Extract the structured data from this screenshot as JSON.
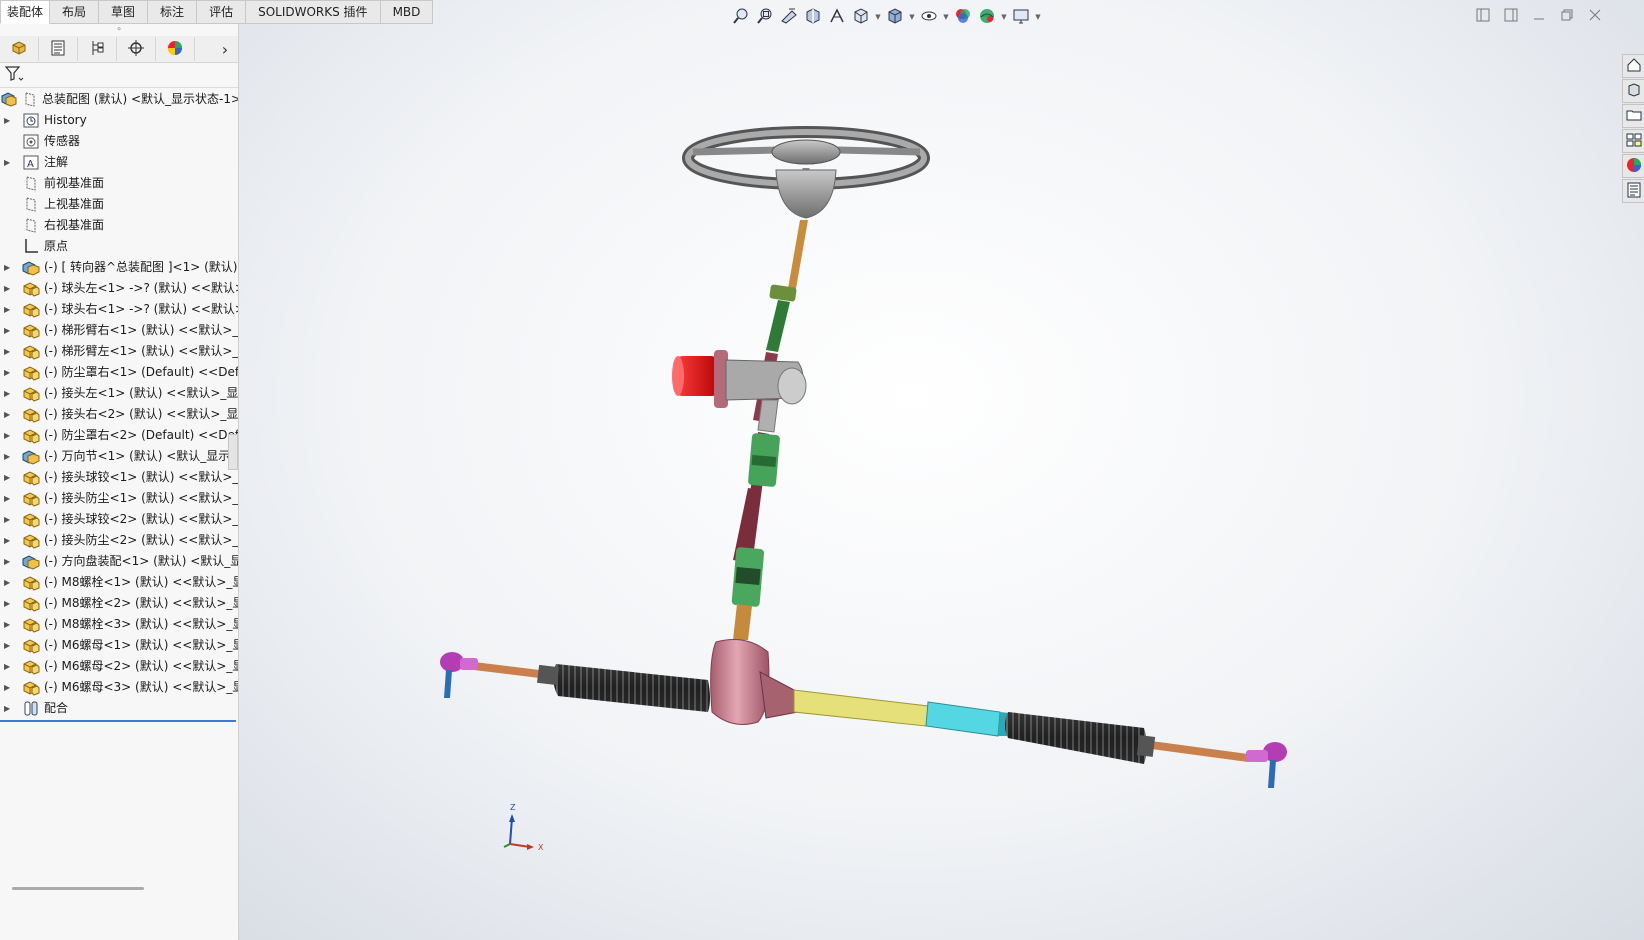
{
  "tabs": [
    {
      "label": "装配体",
      "active": true
    },
    {
      "label": "布局"
    },
    {
      "label": "草图"
    },
    {
      "label": "标注"
    },
    {
      "label": "评估"
    },
    {
      "label": "SOLIDWORKS 插件"
    },
    {
      "label": "MBD"
    }
  ],
  "panel_tabs": [
    {
      "icon": "feature-manager-icon"
    },
    {
      "icon": "property-manager-icon"
    },
    {
      "icon": "configuration-manager-icon"
    },
    {
      "icon": "dimxpert-manager-icon"
    },
    {
      "icon": "display-manager-icon"
    }
  ],
  "panel_more": "›",
  "tree": [
    {
      "label": "总装配图 (默认) <默认_显示状态-1>",
      "icon": "top-assembly-icon",
      "caret": false,
      "indent": 0
    },
    {
      "label": "History",
      "icon": "history-icon",
      "caret": true,
      "indent": 1
    },
    {
      "label": "传感器",
      "icon": "sensor-icon",
      "caret": false,
      "indent": 1
    },
    {
      "label": "注解",
      "icon": "annotation-icon",
      "caret": true,
      "indent": 1
    },
    {
      "label": "前视基准面",
      "icon": "plane-icon",
      "caret": false,
      "indent": 1
    },
    {
      "label": "上视基准面",
      "icon": "plane-icon",
      "caret": false,
      "indent": 1
    },
    {
      "label": "右视基准面",
      "icon": "plane-icon",
      "caret": false,
      "indent": 1
    },
    {
      "label": "原点",
      "icon": "origin-icon",
      "caret": false,
      "indent": 1
    },
    {
      "label": "(-) [ 转向器^总装配图 ]<1> (默认)",
      "icon": "subassembly-icon",
      "caret": true,
      "indent": 1
    },
    {
      "label": "(-) 球头左<1> ->? (默认) <<默认>",
      "icon": "part-icon",
      "caret": true,
      "indent": 1
    },
    {
      "label": "(-) 球头右<1> ->? (默认) <<默认>",
      "icon": "part-icon",
      "caret": true,
      "indent": 1
    },
    {
      "label": "(-) 梯形臂右<1> (默认) <<默认>_显",
      "icon": "part-icon",
      "caret": true,
      "indent": 1
    },
    {
      "label": "(-) 梯形臂左<1> (默认) <<默认>_显",
      "icon": "part-icon",
      "caret": true,
      "indent": 1
    },
    {
      "label": "(-) 防尘罩右<1> (Default) <<Defa",
      "icon": "part-icon",
      "caret": true,
      "indent": 1
    },
    {
      "label": "(-) 接头左<1> (默认) <<默认>_显示",
      "icon": "part-icon",
      "caret": true,
      "indent": 1
    },
    {
      "label": "(-) 接头右<2> (默认) <<默认>_显示",
      "icon": "part-icon",
      "caret": true,
      "indent": 1
    },
    {
      "label": "(-) 防尘罩右<2> (Default) <<Defa",
      "icon": "part-icon",
      "caret": true,
      "indent": 1
    },
    {
      "label": "(-) 万向节<1> (默认) <默认_显示状",
      "icon": "subassembly-icon",
      "caret": true,
      "indent": 1
    },
    {
      "label": "(-) 接头球铰<1> (默认) <<默认>_显",
      "icon": "part-icon",
      "caret": true,
      "indent": 1
    },
    {
      "label": "(-) 接头防尘<1> (默认) <<默认>_显",
      "icon": "part-icon",
      "caret": true,
      "indent": 1
    },
    {
      "label": "(-) 接头球铰<2> (默认) <<默认>_显",
      "icon": "part-icon",
      "caret": true,
      "indent": 1
    },
    {
      "label": "(-) 接头防尘<2> (默认) <<默认>_显",
      "icon": "part-icon",
      "caret": true,
      "indent": 1
    },
    {
      "label": "(-) 方向盘装配<1> (默认) <默认_显",
      "icon": "subassembly-icon",
      "caret": true,
      "indent": 1
    },
    {
      "label": "(-) M8螺栓<1> (默认) <<默认>_显",
      "icon": "part-icon",
      "caret": true,
      "indent": 1
    },
    {
      "label": "(-) M8螺栓<2> (默认) <<默认>_显",
      "icon": "part-icon",
      "caret": true,
      "indent": 1
    },
    {
      "label": "(-) M8螺栓<3> (默认) <<默认>_显",
      "icon": "part-icon",
      "caret": true,
      "indent": 1
    },
    {
      "label": "(-) M6螺母<1> (默认) <<默认>_显",
      "icon": "part-icon",
      "caret": true,
      "indent": 1
    },
    {
      "label": "(-) M6螺母<2> (默认) <<默认>_显",
      "icon": "part-icon",
      "caret": true,
      "indent": 1
    },
    {
      "label": "(-) M6螺母<3> (默认) <<默认>_显",
      "icon": "part-icon",
      "caret": true,
      "indent": 1
    },
    {
      "label": "配合",
      "icon": "mates-icon",
      "caret": true,
      "indent": 1
    }
  ],
  "heads_up_toolbar": [
    {
      "icon": "zoom-to-fit-icon",
      "drop": false
    },
    {
      "icon": "zoom-to-area-icon",
      "drop": false
    },
    {
      "icon": "previous-view-icon",
      "drop": false
    },
    {
      "icon": "section-view-icon",
      "drop": false
    },
    {
      "icon": "dynamic-annotation-icon",
      "drop": false
    },
    {
      "icon": "view-orientation-icon",
      "drop": true
    },
    {
      "icon": "display-style-icon",
      "drop": true
    },
    {
      "icon": "hide-show-items-icon",
      "drop": true
    },
    {
      "icon": "edit-appearance-icon",
      "drop": false
    },
    {
      "icon": "apply-scene-icon",
      "drop": true
    },
    {
      "icon": "view-settings-icon",
      "drop": true
    }
  ],
  "window_controls": [
    "tile-left-icon",
    "tile-right-icon",
    "minimize-icon",
    "restore-icon",
    "close-icon"
  ],
  "task_pane": [
    "home-icon",
    "design-library-icon",
    "file-explorer-icon",
    "view-palette-icon",
    "appearances-icon",
    "custom-properties-icon"
  ],
  "triad": {
    "z": "Z",
    "x": "X"
  },
  "colors": {
    "accent": "#3d7bd0",
    "active_tab_bg": "#ffffff",
    "tab_bg": "#e9e9e9",
    "panel_bg": "#f7f7f7"
  }
}
